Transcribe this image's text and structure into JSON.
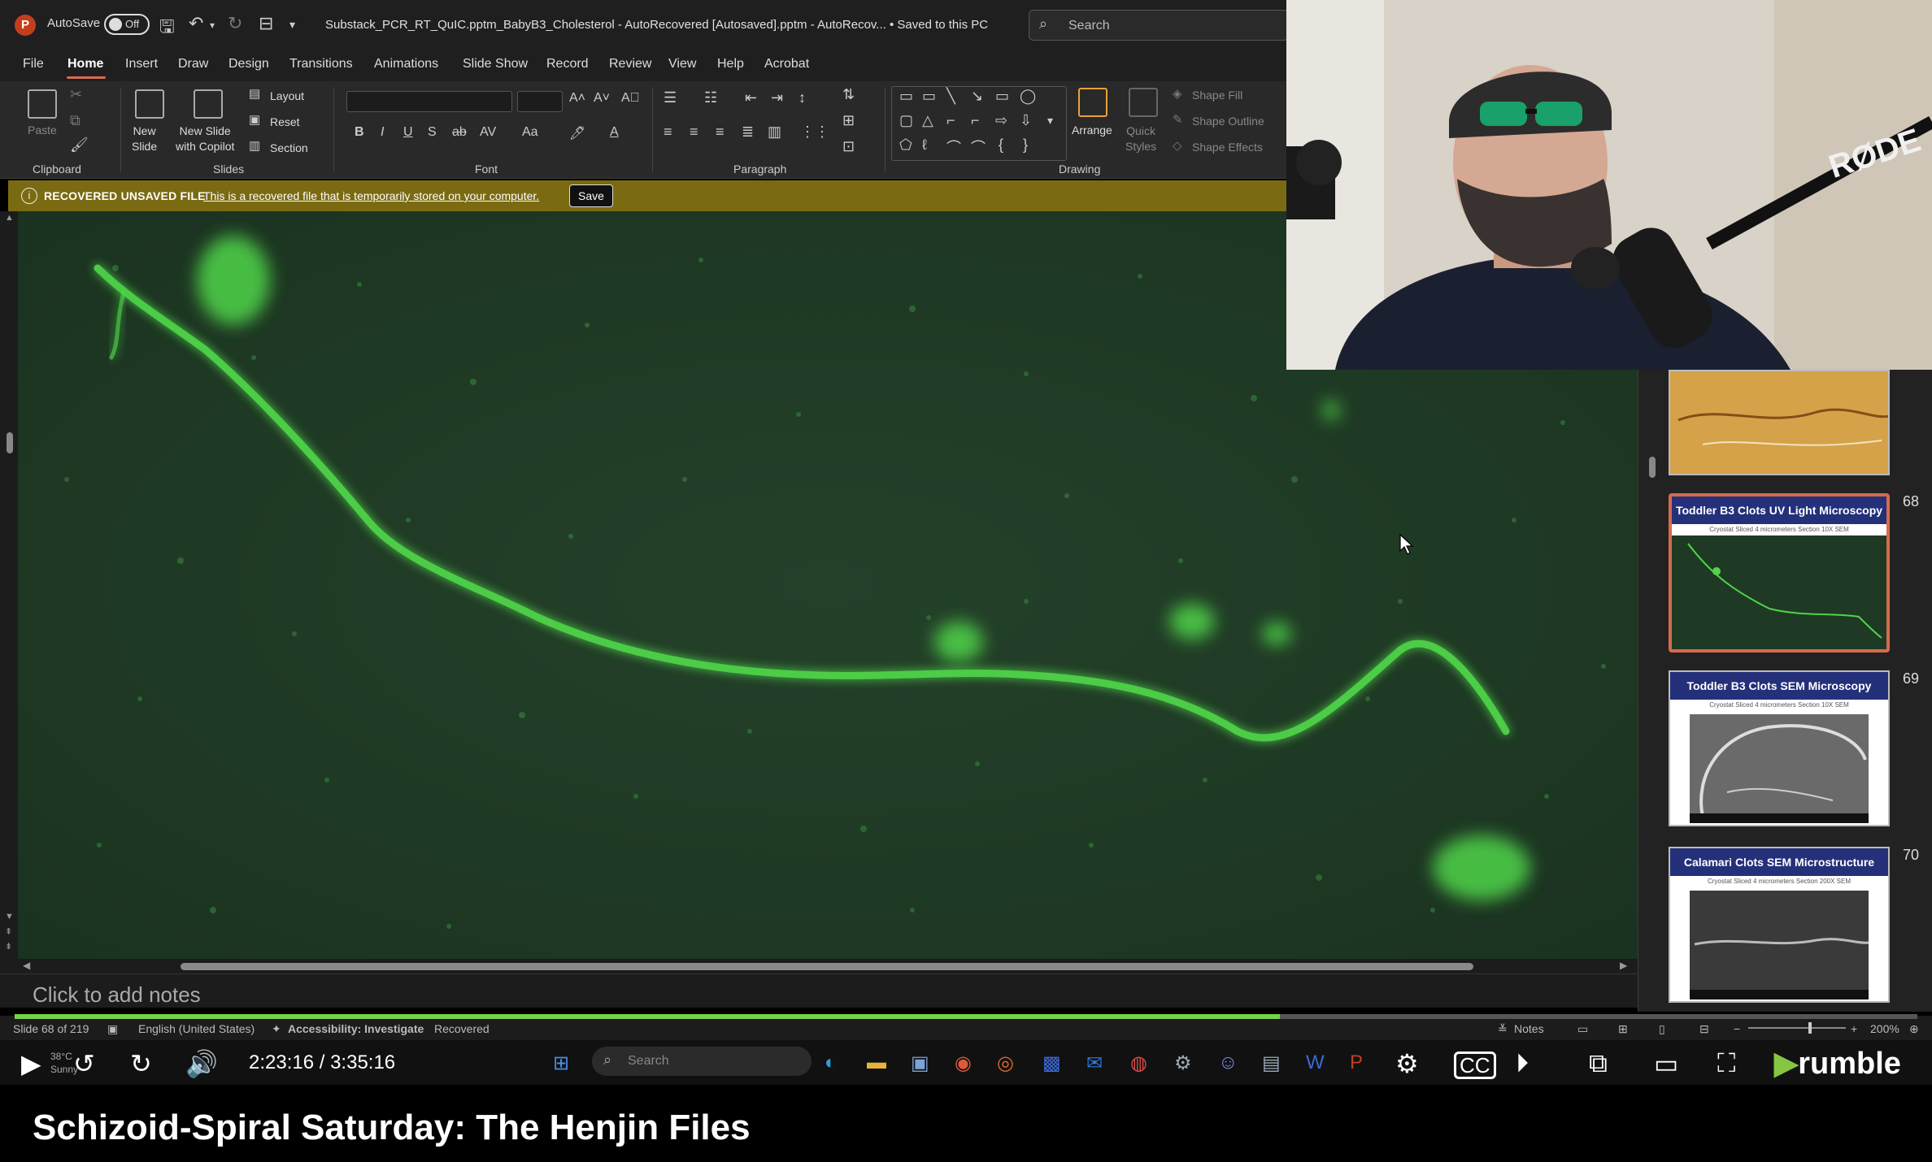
{
  "titlebar": {
    "autosave_label": "AutoSave",
    "autosave_state": "Off",
    "document_title": "Substack_PCR_RT_QuIC.pptm_BabyB3_Cholesterol  -  AutoRecovered [Autosaved].pptm  -  AutoRecov...  •  Saved to this PC",
    "search_placeholder": "Search"
  },
  "menu": {
    "tabs": [
      "File",
      "Home",
      "Insert",
      "Draw",
      "Design",
      "Transitions",
      "Animations",
      "Slide Show",
      "Record",
      "Review",
      "View",
      "Help",
      "Acrobat"
    ],
    "active_tab": "Home"
  },
  "ribbon": {
    "clipboard": {
      "paste": "Paste",
      "group": "Clipboard"
    },
    "slides": {
      "new_slide": "New\nSlide",
      "new_slide_copilot": "New Slide\nwith Copilot",
      "layout": "Layout",
      "reset": "Reset",
      "section": "Section",
      "group": "Slides"
    },
    "font": {
      "group": "Font"
    },
    "paragraph": {
      "group": "Paragraph"
    },
    "drawing": {
      "arrange": "Arrange",
      "quick_styles": "Quick\nStyles",
      "shape_fill": "Shape Fill",
      "shape_outline": "Shape Outline",
      "shape_effects": "Shape Effects",
      "group": "Drawing"
    }
  },
  "recovered_bar": {
    "label": "RECOVERED UNSAVED FILE",
    "message": "This is a recovered file that is temporarily stored on your computer.",
    "save_button": "Save"
  },
  "notes": {
    "placeholder": "Click to add notes"
  },
  "thumbnails": [
    {
      "number": "",
      "title": ""
    },
    {
      "number": "68",
      "title": "Toddler B3 Clots UV Light Microscopy",
      "subtitle": "Cryostat Sliced 4 micrometers Section 10X SEM"
    },
    {
      "number": "69",
      "title": "Toddler B3 Clots SEM Microscopy",
      "subtitle": "Cryostat Sliced 4 micrometers Section 10X SEM"
    },
    {
      "number": "70",
      "title": "Calamari Clots SEM Microstructure",
      "subtitle": "Cryostat Sliced 4 micrometers Section 200X SEM"
    }
  ],
  "statusbar": {
    "slide_counter": "Slide 68 of 219",
    "language": "English (United States)",
    "accessibility": "Accessibility: Investigate",
    "recovered": "Recovered",
    "notes": "Notes",
    "zoom": "200%"
  },
  "player": {
    "current_time": "2:23:16",
    "total_time": "3:35:16",
    "time_display": "2:23:16 / 3:35:16",
    "progress": 0.665,
    "weather_temp": "38°C",
    "weather_desc": "Sunny",
    "taskbar_search": "Search",
    "brand": "rumble",
    "brand_color": "#85c742"
  },
  "video_title": "Schizoid-Spiral Saturday: The Henjin Files",
  "webcam": {
    "mic_brand": "RØDE"
  },
  "colors": {
    "accent": "#d66b4c",
    "recovered_bar": "#7a6a12",
    "fluorescence_green": "#4fd44a",
    "slide_bg": "#1f3a24",
    "progress_fill": "#74d34a"
  }
}
